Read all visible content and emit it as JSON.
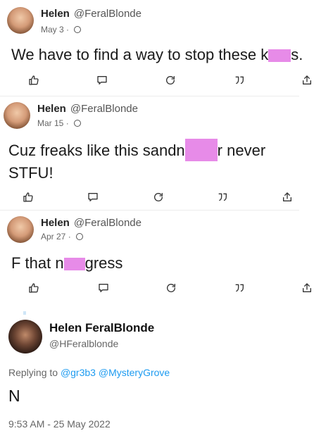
{
  "posts": [
    {
      "name": "Helen",
      "handle": "@FeralBlonde",
      "date": "May 3",
      "text_before": "We have to find a way to stop these k",
      "text_after": "s."
    },
    {
      "name": "Helen",
      "handle": "@FeralBlonde",
      "date": "Mar 15",
      "text_before": "Cuz freaks like this sandn",
      "text_after": "r never",
      "text_line2": "STFU!"
    },
    {
      "name": "Helen",
      "handle": "@FeralBlonde",
      "date": "Apr 27",
      "text_before": "F that n",
      "text_after": "gress"
    }
  ],
  "meta_separator": "·",
  "action_icons": [
    "thumbs-up-icon",
    "comment-icon",
    "repost-icon",
    "quote-icon",
    "share-icon"
  ],
  "tweet": {
    "display_name": "Helen FeralBlonde",
    "handle": "@HFeralblonde",
    "replying_prefix": "Replying to",
    "reply_user_1": "@gr3b3",
    "reply_user_2": "@MysteryGrove",
    "text": "N",
    "timestamp": "9:53 AM - 25 May 2022"
  },
  "colors": {
    "redaction": "#e78be8",
    "link": "#1d9bf0"
  }
}
